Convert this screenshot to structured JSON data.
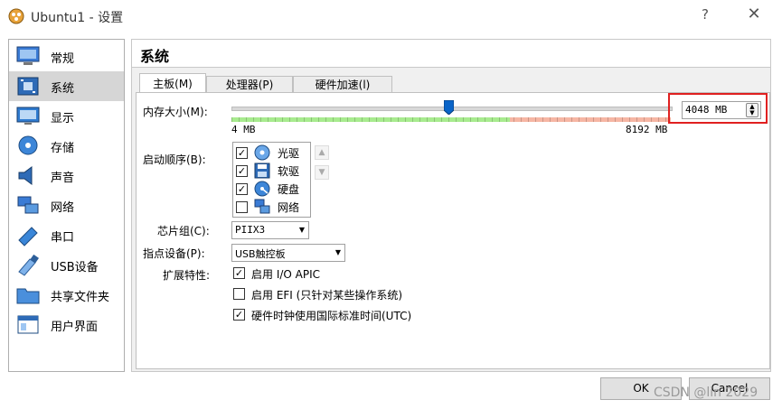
{
  "window": {
    "title": "Ubuntu1 - 设置",
    "help": "?",
    "close": "✕"
  },
  "sidebar": {
    "items": [
      {
        "label": "常规",
        "icon": "monitor-general-icon"
      },
      {
        "label": "系统",
        "icon": "motherboard-icon"
      },
      {
        "label": "显示",
        "icon": "display-icon"
      },
      {
        "label": "存储",
        "icon": "storage-disc-icon"
      },
      {
        "label": "声音",
        "icon": "speaker-icon"
      },
      {
        "label": "网络",
        "icon": "network-icon"
      },
      {
        "label": "串口",
        "icon": "serial-port-icon"
      },
      {
        "label": "USB设备",
        "icon": "usb-icon"
      },
      {
        "label": "共享文件夹",
        "icon": "shared-folder-icon"
      },
      {
        "label": "用户界面",
        "icon": "user-interface-icon"
      }
    ],
    "selected": "系统"
  },
  "section": {
    "title": "系统"
  },
  "tabs": [
    {
      "label": "主板(M)",
      "active": true
    },
    {
      "label": "处理器(P)",
      "active": false
    },
    {
      "label": "硬件加速(l)",
      "active": false
    }
  ],
  "memory": {
    "label": "内存大小(M):",
    "value": "4048 MB",
    "min_label": "4 MB",
    "max_label": "8192 MB",
    "min_mb": 4,
    "max_mb": 8192,
    "current_mb": 4048
  },
  "boot": {
    "label": "启动顺序(B):",
    "items": [
      {
        "label": "光驱",
        "checked": true,
        "icon": "optical-drive-icon"
      },
      {
        "label": "软驱",
        "checked": true,
        "icon": "floppy-icon"
      },
      {
        "label": "硬盘",
        "checked": true,
        "icon": "hard-disk-icon"
      },
      {
        "label": "网络",
        "checked": false,
        "icon": "network-boot-icon"
      }
    ]
  },
  "chipset": {
    "label": "芯片组(C):",
    "value": "PIIX3"
  },
  "pointing": {
    "label": "指点设备(P):",
    "value": "USB触控板"
  },
  "features": {
    "label": "扩展特性:",
    "items": [
      {
        "label": "启用 I/O APIC",
        "checked": true
      },
      {
        "label": "启用 EFI (只针对某些操作系统)",
        "checked": false
      },
      {
        "label": "硬件时钟使用国际标准时间(UTC)",
        "checked": true
      }
    ]
  },
  "buttons": {
    "ok": "OK",
    "cancel": "Cancel"
  },
  "watermark": "CSDN @lin 2029",
  "colors": {
    "accent": "#0a64c8",
    "highlight": "#e02020",
    "slider_safe": "#a8eb8f",
    "slider_warn": "#f6b6a4"
  }
}
